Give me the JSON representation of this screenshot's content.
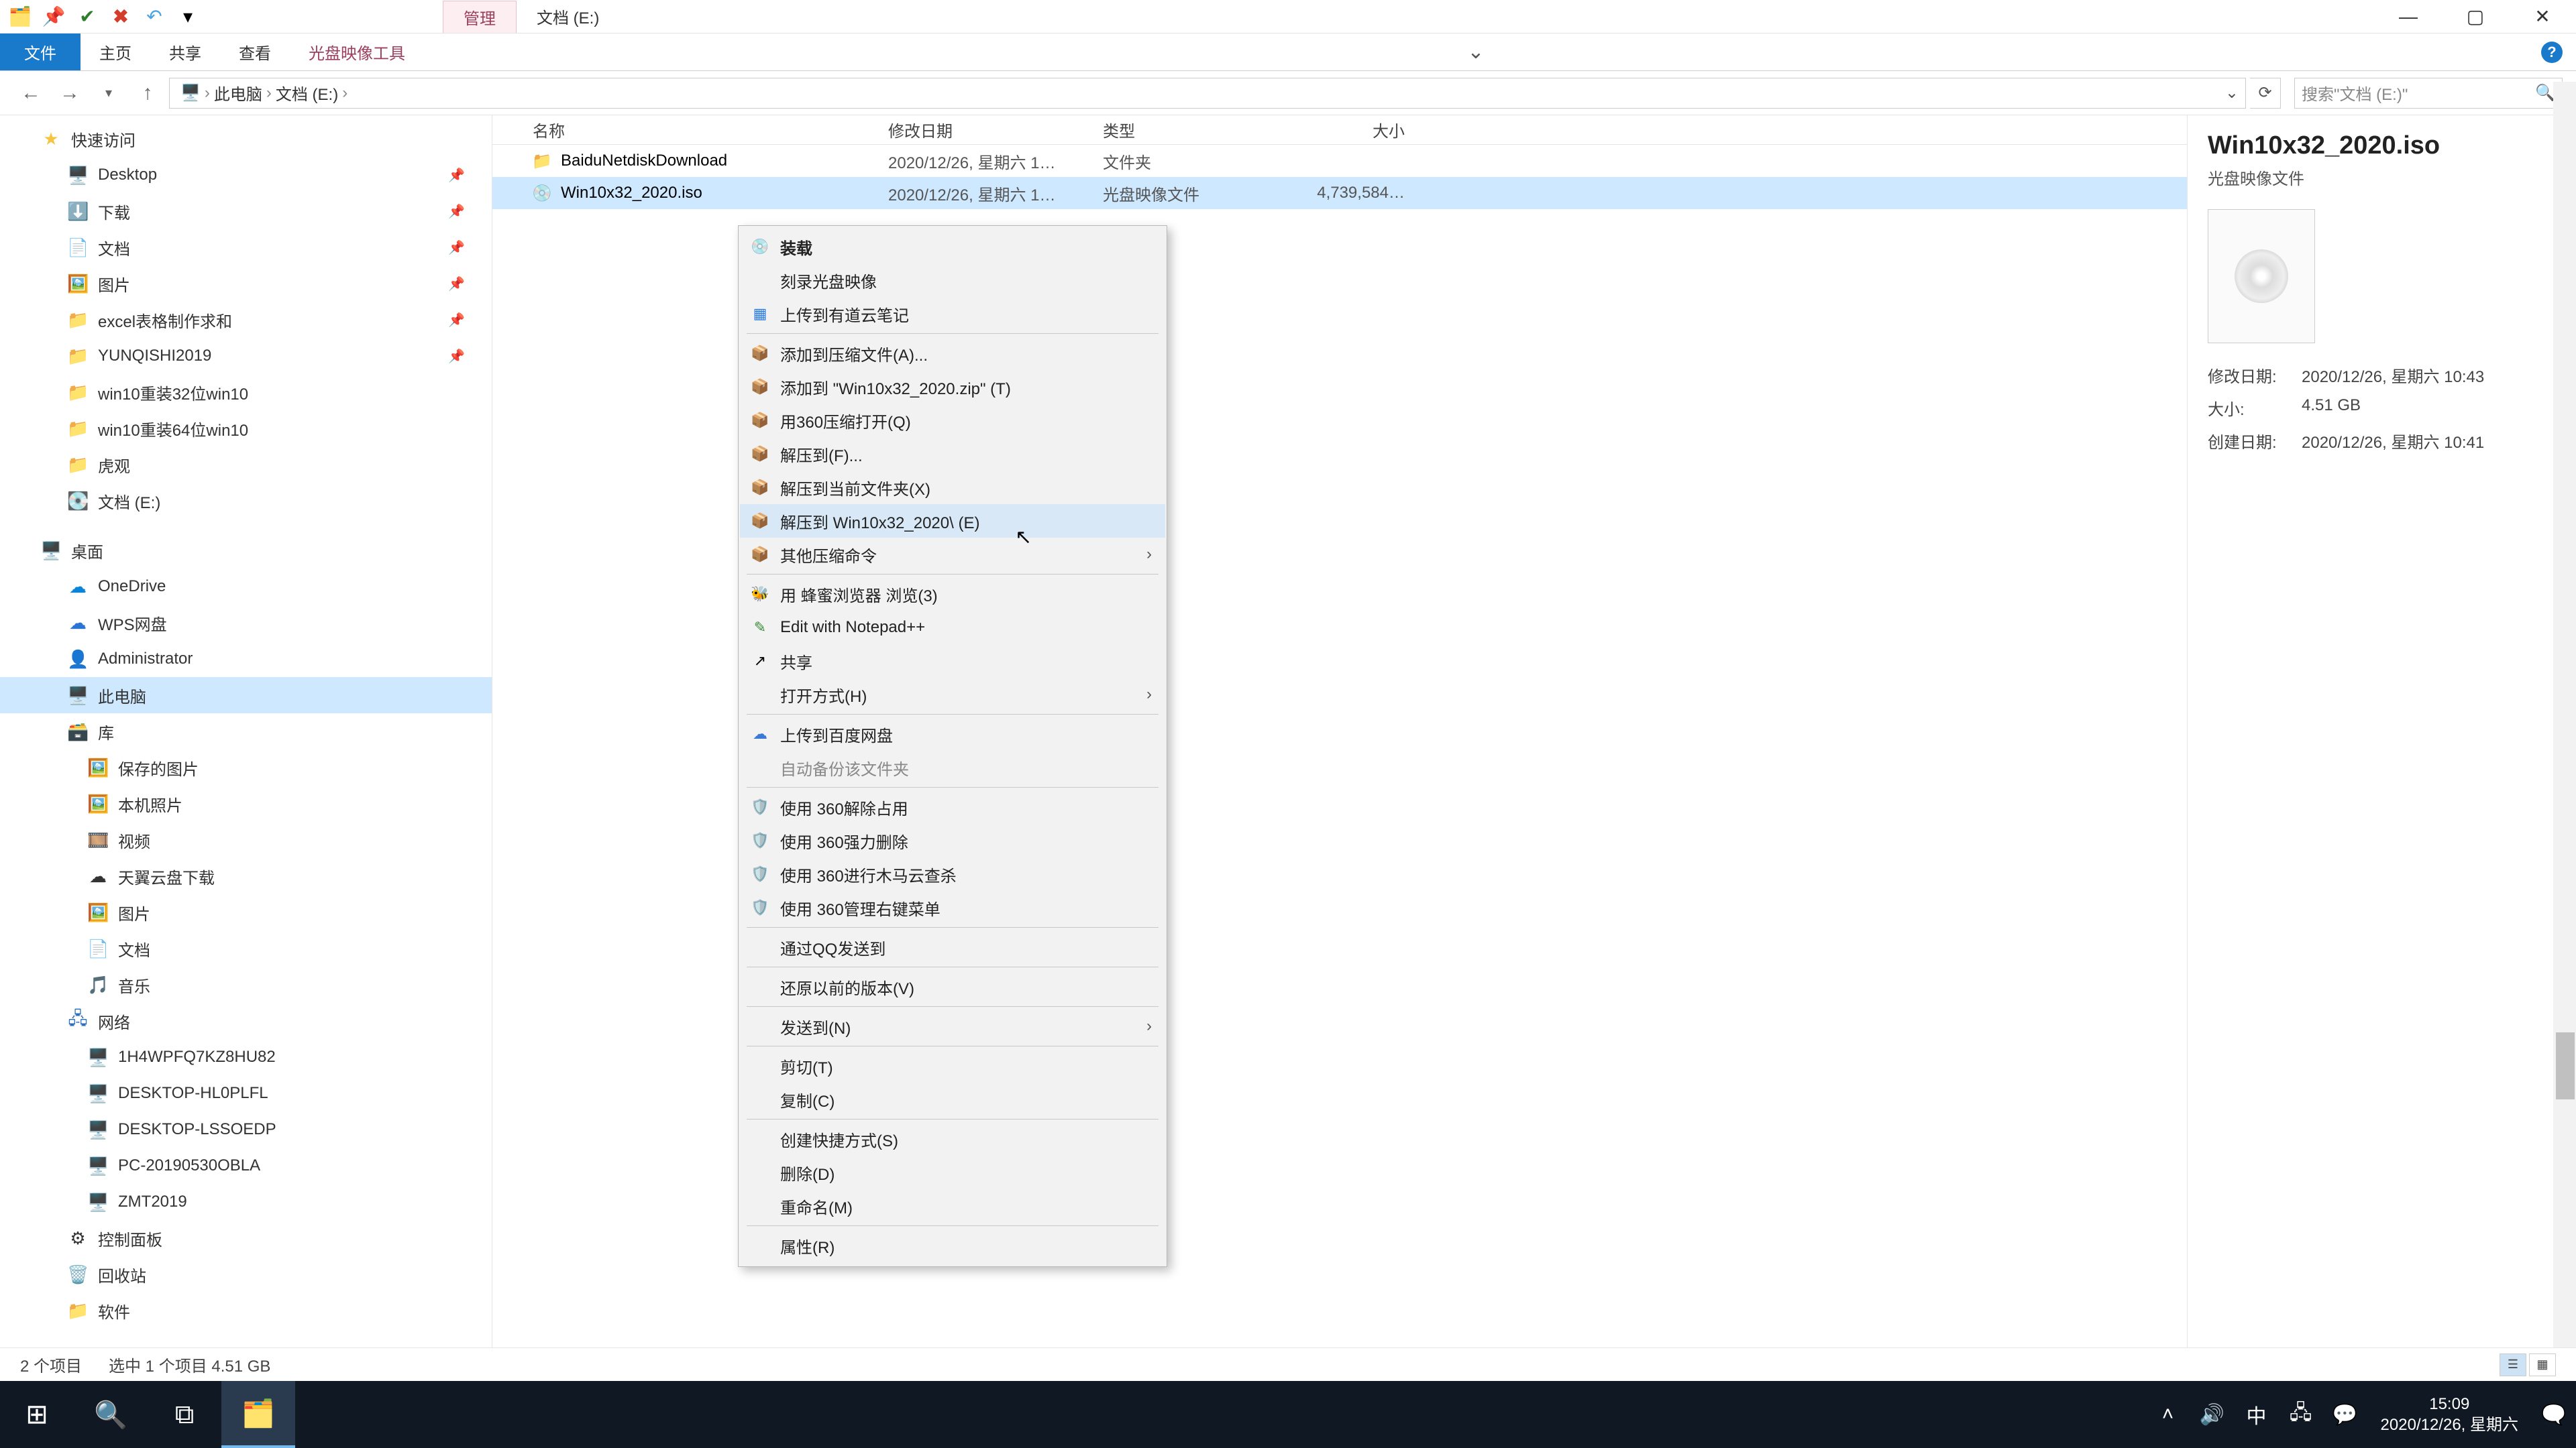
{
  "title": "文档 (E:)",
  "ribbon": {
    "manage": "管理",
    "file": "文件",
    "home": "主页",
    "share": "共享",
    "view": "查看",
    "tool": "光盘映像工具"
  },
  "breadcrumb": {
    "root": "此电脑",
    "drive": "文档 (E:)"
  },
  "search": {
    "placeholder": "搜索\"文档 (E:)\""
  },
  "columns": {
    "name": "名称",
    "date": "修改日期",
    "type": "类型",
    "size": "大小"
  },
  "rows": [
    {
      "name": "BaiduNetdiskDownload",
      "date": "2020/12/26, 星期六 1…",
      "type": "文件夹",
      "size": "",
      "icon": "📁"
    },
    {
      "name": "Win10x32_2020.iso",
      "date": "2020/12/26, 星期六 1…",
      "type": "光盘映像文件",
      "size": "4,739,584…",
      "icon": "💿"
    }
  ],
  "sidebar": {
    "quick": "快速访问",
    "items1": [
      "Desktop",
      "下载",
      "文档",
      "图片",
      "excel表格制作求和",
      "YUNQISHI2019",
      "win10重装32位win10",
      "win10重装64位win10",
      "虎观",
      "文档 (E:)"
    ],
    "desktop": "桌面",
    "onedrive": "OneDrive",
    "wps": "WPS网盘",
    "admin": "Administrator",
    "pc": "此电脑",
    "lib": "库",
    "libs": [
      "保存的图片",
      "本机照片",
      "视频",
      "天翼云盘下载",
      "图片",
      "文档",
      "音乐"
    ],
    "net": "网络",
    "netitems": [
      "1H4WPFQ7KZ8HU82",
      "DESKTOP-HL0PLFL",
      "DESKTOP-LSSOEDP",
      "PC-20190530OBLA",
      "ZMT2019"
    ],
    "cp": "控制面板",
    "rb": "回收站",
    "sw": "软件"
  },
  "ctx": {
    "mount": "装载",
    "burn": "刻录光盘映像",
    "youdao": "上传到有道云笔记",
    "addarchive": "添加到压缩文件(A)...",
    "addzip": "添加到 \"Win10x32_2020.zip\" (T)",
    "open360": "用360压缩打开(Q)",
    "extractf": "解压到(F)...",
    "extracthere": "解压到当前文件夹(X)",
    "extractdir": "解压到 Win10x32_2020\\ (E)",
    "othercomp": "其他压缩命令",
    "beebrowse": "用 蜂蜜浏览器 浏览(3)",
    "notepad": "Edit with Notepad++",
    "share": "共享",
    "openwith": "打开方式(H)",
    "baidu": "上传到百度网盘",
    "autobak": "自动备份该文件夹",
    "unlock360": "使用 360解除占用",
    "force360": "使用 360强力删除",
    "trojan360": "使用 360进行木马云查杀",
    "menu360": "使用 360管理右键菜单",
    "qqsend": "通过QQ发送到",
    "restore": "还原以前的版本(V)",
    "sendto": "发送到(N)",
    "cut": "剪切(T)",
    "copy": "复制(C)",
    "shortcut": "创建快捷方式(S)",
    "delete": "删除(D)",
    "rename": "重命名(M)",
    "props": "属性(R)"
  },
  "details": {
    "title": "Win10x32_2020.iso",
    "type": "光盘映像文件",
    "modlabel": "修改日期:",
    "moddate": "2020/12/26, 星期六 10:43",
    "sizelabel": "大小:",
    "size": "4.51 GB",
    "createlabel": "创建日期:",
    "createdate": "2020/12/26, 星期六 10:41"
  },
  "status": {
    "items": "2 个项目",
    "selected": "选中 1 个项目  4.51 GB"
  },
  "taskbar": {
    "time": "15:09",
    "date": "2020/12/26, 星期六",
    "ime": "中"
  }
}
